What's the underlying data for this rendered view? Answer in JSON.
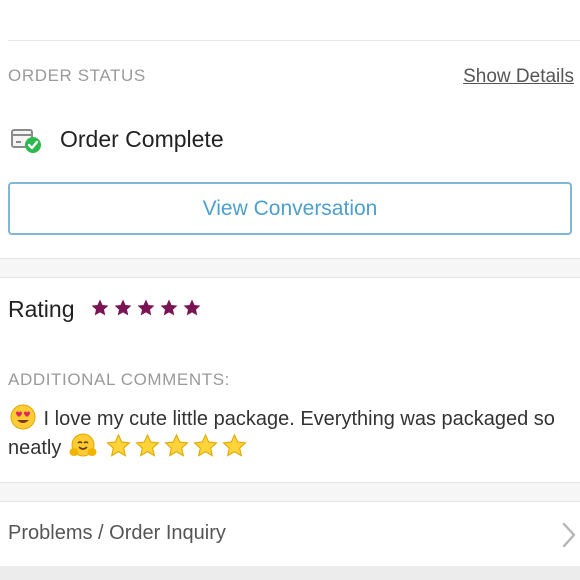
{
  "order_status": {
    "section_label": "ORDER STATUS",
    "show_details_label": "Show Details",
    "status_text": "Order Complete",
    "status_icon": "package-check-icon"
  },
  "conversation": {
    "button_label": "View Conversation"
  },
  "rating": {
    "label": "Rating",
    "stars_filled": 5,
    "stars_total": 5,
    "star_color": "#7a1455"
  },
  "comments": {
    "section_label": "ADDITIONAL COMMENTS:",
    "text_part1": " I love my cute little package. Everything was packaged so neatly ",
    "emojis": [
      "heart-eyes-emoji",
      "hugging-emoji",
      "star-emoji"
    ]
  },
  "inquiry": {
    "label": "Problems / Order Inquiry"
  },
  "colors": {
    "accent_blue": "#4d9fcc",
    "button_border": "#7fb7d6",
    "success_green": "#2db84d"
  }
}
